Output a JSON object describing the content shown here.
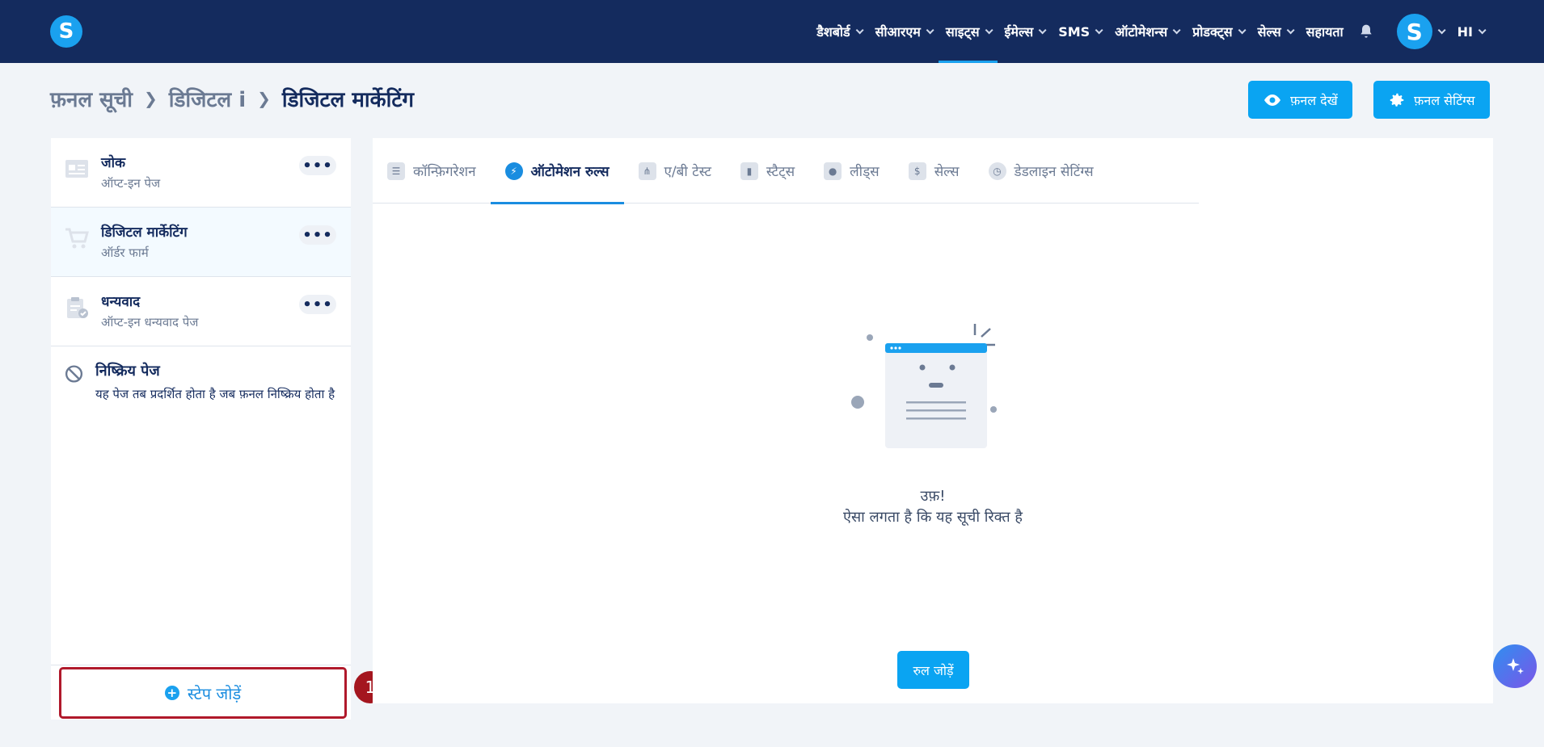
{
  "app": {
    "logo_letter": "S"
  },
  "nav": {
    "items": [
      {
        "label": "डैशबोर्ड"
      },
      {
        "label": "सीआरएम"
      },
      {
        "label": "साइट्स"
      },
      {
        "label": "ईमेल्स"
      },
      {
        "label": "SMS"
      },
      {
        "label": "ऑटोमेशन्स"
      },
      {
        "label": "प्रोडक्ट्स"
      },
      {
        "label": "सेल्स"
      },
      {
        "label": "सहायता"
      }
    ],
    "active": "साइट्स",
    "avatar_letter": "S",
    "language": "HI"
  },
  "breadcrumb": {
    "root": "फ़नल सूची",
    "parent": "डिजिटल i",
    "current": "डिजिटल मार्केटिंग"
  },
  "header_buttons": {
    "view_funnel": "फ़नल देखें",
    "funnel_settings": "फ़नल सेटिंग्स"
  },
  "sidebar": {
    "steps": [
      {
        "title": "जोक",
        "subtitle": "ऑप्ट-इन पेज"
      },
      {
        "title": "डिजिटल मार्केटिंग",
        "subtitle": "ऑर्डर फार्म"
      },
      {
        "title": "धन्यवाद",
        "subtitle": "ऑप्ट-इन धन्यवाद पेज"
      }
    ],
    "inactive": {
      "title": "निष्क्रिय पेज",
      "description": "यह पेज तब प्रदर्शित होता है जब फ़नल निष्क्रिय होता है"
    },
    "add_step": "स्टेप जोड़ें",
    "marker": "1"
  },
  "tabs": [
    {
      "label": "कॉन्फ़िगरेशन"
    },
    {
      "label": "ऑटोमेशन रुल्स"
    },
    {
      "label": "ए/बी टेस्ट"
    },
    {
      "label": "स्टैट्स"
    },
    {
      "label": "लीड्स"
    },
    {
      "label": "सेल्स"
    },
    {
      "label": "डेडलाइन सेटिंग्स"
    }
  ],
  "empty_state": {
    "title": "उफ़!",
    "message": "ऐसा लगता है कि यह सूची रिक्त है",
    "add_rule": "रुल जोड़ें"
  },
  "colors": {
    "nav_bg": "#142b5e",
    "accent": "#0aa4f2",
    "marker": "#a4161f"
  }
}
